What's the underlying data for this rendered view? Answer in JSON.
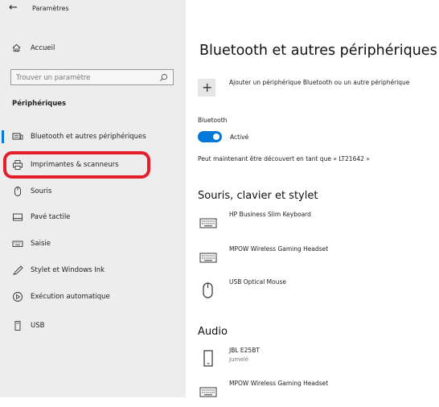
{
  "window": {
    "title": "Paramètres"
  },
  "sidebar": {
    "home_label": "Accueil",
    "search_placeholder": "Trouver un paramètre",
    "section_label": "Périphériques",
    "items": [
      {
        "label": "Bluetooth et autres périphériques",
        "icon": "bluetooth-devices-icon",
        "selected": true
      },
      {
        "label": "Imprimantes & scanneurs",
        "icon": "printer-icon",
        "selected": false
      },
      {
        "label": "Souris",
        "icon": "mouse-icon",
        "selected": false
      },
      {
        "label": "Pavé tactile",
        "icon": "touchpad-icon",
        "selected": false
      },
      {
        "label": "Saisie",
        "icon": "keyboard-icon",
        "selected": false
      },
      {
        "label": "Stylet et Windows Ink",
        "icon": "pen-icon",
        "selected": false
      },
      {
        "label": "Exécution automatique",
        "icon": "autoplay-icon",
        "selected": false
      },
      {
        "label": "USB",
        "icon": "usb-icon",
        "selected": false
      }
    ]
  },
  "main": {
    "title": "Bluetooth et autres périphériques",
    "add_device_label": "Ajouter un périphérique Bluetooth ou un autre périphérique",
    "bluetooth_label": "Bluetooth",
    "toggle_state": "Activé",
    "discoverable_text": "Peut maintenant être découvert en tant que « LT21642 »",
    "sections": [
      {
        "title": "Souris, clavier et stylet",
        "devices": [
          {
            "name": "HP Business Slim Keyboard",
            "icon": "keyboard-icon"
          },
          {
            "name": "MPOW Wireless Gaming Headset",
            "icon": "keyboard-icon"
          },
          {
            "name": "USB Optical Mouse",
            "icon": "mouse-icon"
          }
        ]
      },
      {
        "title": "Audio",
        "devices": [
          {
            "name": "JBL E25BT",
            "status": "Jumelé",
            "icon": "phone-icon"
          },
          {
            "name": "MPOW Wireless Gaming Headset",
            "icon": "keyboard-icon"
          }
        ]
      }
    ]
  },
  "colors": {
    "accent": "#0078d7",
    "highlight_ring": "#e41e2b",
    "sidebar_bg": "#ededed"
  }
}
